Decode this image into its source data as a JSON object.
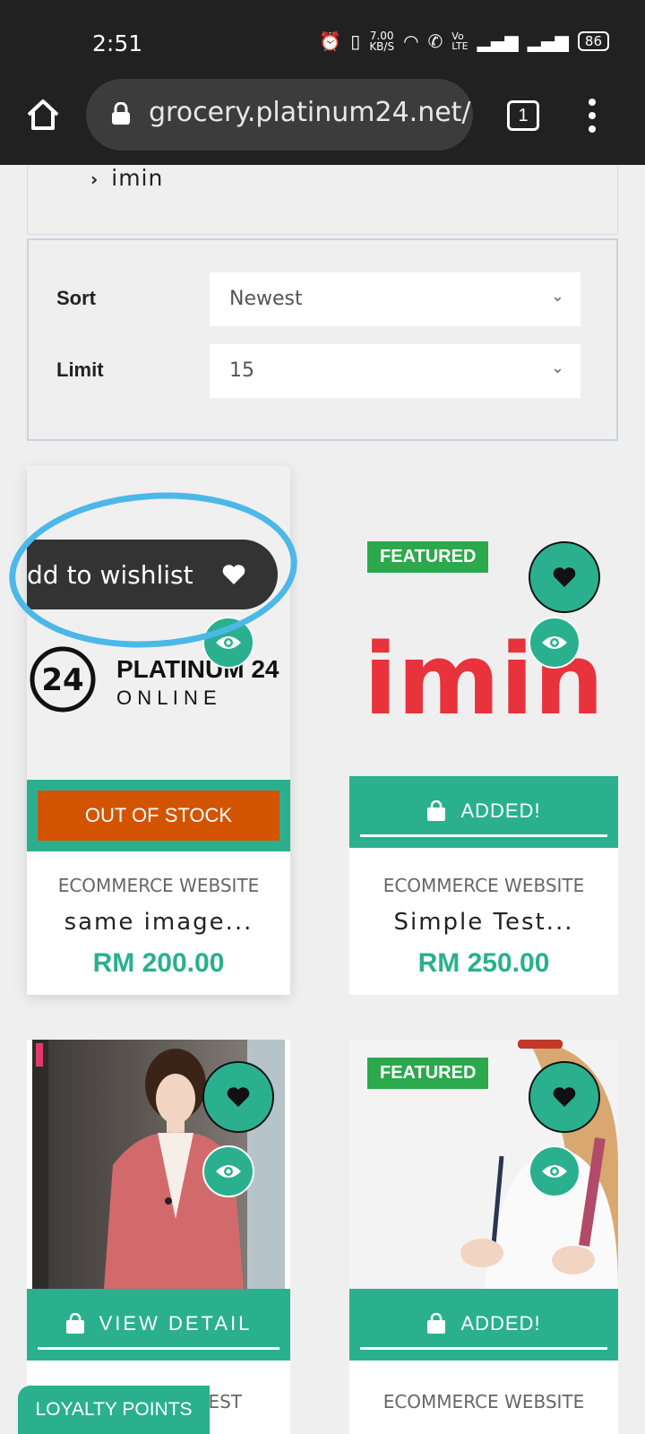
{
  "status_bar": {
    "time": "2:51",
    "speed_value": "7.00",
    "speed_unit": "KB/S",
    "battery": "86"
  },
  "browser": {
    "url": "grocery.platinum24.net/",
    "tab_count": "1"
  },
  "category_list": {
    "items": [
      {
        "label": "imin"
      }
    ]
  },
  "filters": {
    "sort_label": "Sort",
    "sort_value": "Newest",
    "limit_label": "Limit",
    "limit_value": "15"
  },
  "tooltip": {
    "text": "dd to wishlist"
  },
  "products": [
    {
      "logo_main": "PLATINUM 24",
      "logo_sub": "O N L I N E",
      "logo_badge": "24",
      "action_label": "OUT OF STOCK",
      "category": "ECOMMERCE WEBSITE",
      "name": "same image...",
      "price": "RM 200.00"
    },
    {
      "badge": "FEATURED",
      "logo_text": "imin",
      "action_label": "ADDED!",
      "category": "ECOMMERCE WEBSITE",
      "name": "Simple Test...",
      "price": "RM 250.00"
    },
    {
      "action_label": "VIEW DETAIL",
      "category_partial": "EST"
    },
    {
      "badge": "FEATURED",
      "action_label": "ADDED!",
      "category": "ECOMMERCE WEBSITE"
    }
  ],
  "loyalty_button": "LOYALTY POINTS",
  "colors": {
    "accent": "#2ab08e",
    "featured": "#2ba94c",
    "out_of_stock": "#d35400",
    "imin_red": "#e8323c"
  }
}
